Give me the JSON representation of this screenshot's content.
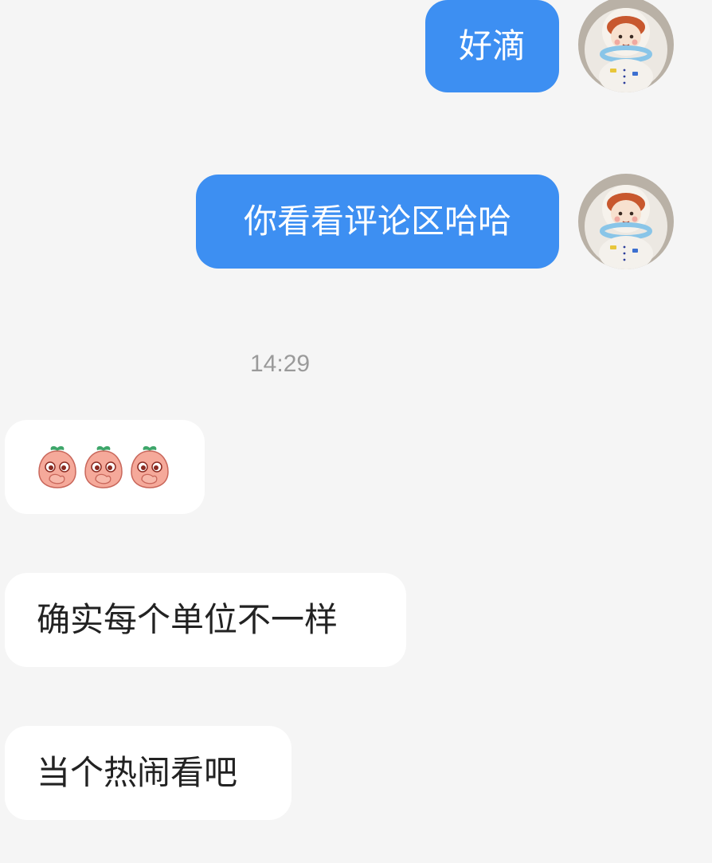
{
  "colors": {
    "background": "#f5f5f5",
    "sent_bubble": "#3d8ff2",
    "received_bubble": "#ffffff",
    "timestamp": "#9a9a9a"
  },
  "messages": {
    "sent_1": "好滴",
    "sent_2": "你看看评论区哈哈",
    "timestamp": "14:29",
    "received_sticker": {
      "icon": "peach-cover-mouth-emoji",
      "count": 3
    },
    "received_1": "确实每个单位不一样",
    "received_2": "当个热闹看吧"
  },
  "avatar": {
    "icon": "astronaut-doll-avatar"
  }
}
